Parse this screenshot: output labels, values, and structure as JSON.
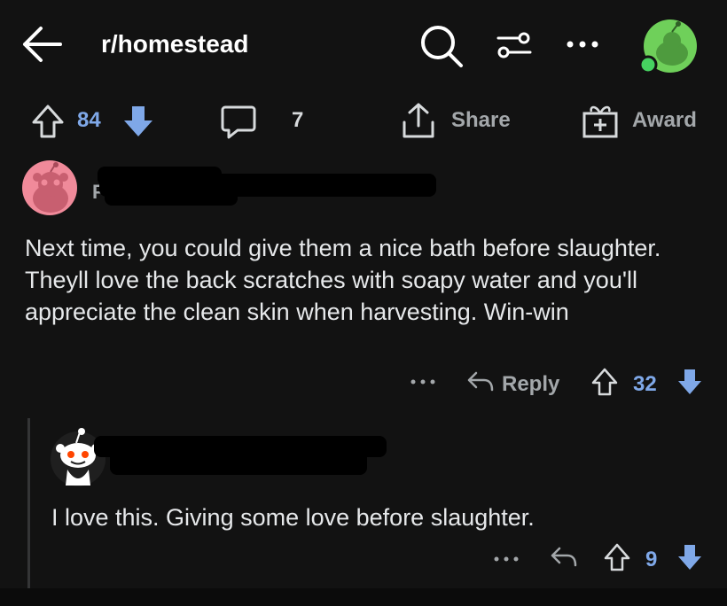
{
  "header": {
    "subreddit": "r/homestead",
    "icons": [
      "back-arrow-icon",
      "search-icon",
      "filter-icon",
      "more-icon",
      "avatar"
    ]
  },
  "post_actions": {
    "votes": "84",
    "comments": "7",
    "share_label": "Share",
    "award_label": "Award"
  },
  "comments": [
    {
      "username_visible": "F",
      "text": "Next time, you could give them a nice bath before slaughter. Theyll love the back scratches with soapy water and you'll appreciate the clean skin when harvesting. Win-win",
      "reply_label": "Reply",
      "votes": "32"
    },
    {
      "text": "I love this. Giving some love before slaughter.",
      "votes": "9"
    }
  ],
  "colors": {
    "background": "#121212",
    "upvote_accent": "#7fa8e8",
    "text": "#e6e8ea",
    "muted": "#a3a7aa"
  }
}
